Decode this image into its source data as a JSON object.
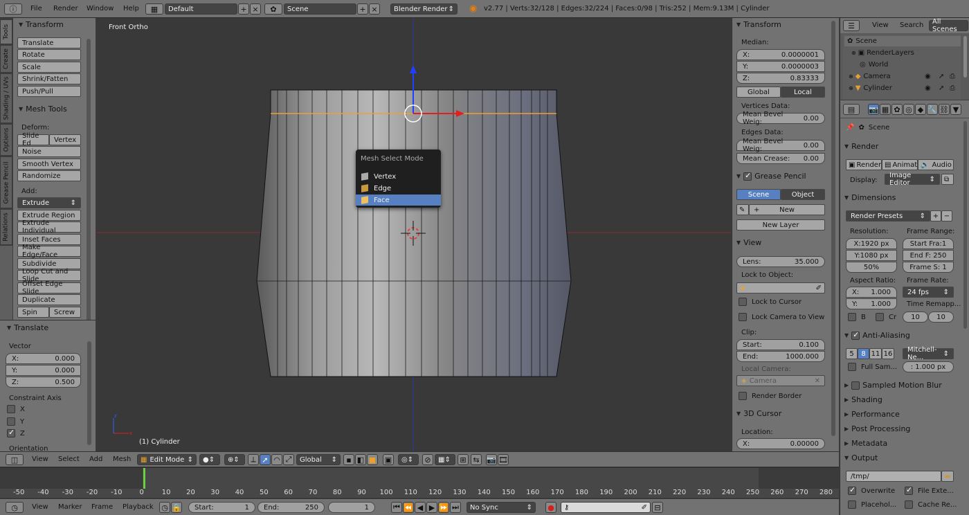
{
  "topbar": {
    "menus": [
      "File",
      "Render",
      "Window",
      "Help"
    ],
    "layout": "Default",
    "scene": "Scene",
    "engine": "Blender Render",
    "stats": "v2.77 | Verts:32/128 | Edges:32/224 | Faces:0/98 | Tris:252 | Mem:9.13M | Cylinder"
  },
  "tabs_left": [
    "Tools",
    "Create",
    "Shading / UVs",
    "Options",
    "Grease Pencil",
    "Relations"
  ],
  "tools": {
    "transform_title": "Transform",
    "transform": [
      "Translate",
      "Rotate",
      "Scale",
      "Shrink/Fatten",
      "Push/Pull"
    ],
    "mesh_tools_title": "Mesh Tools",
    "deform_label": "Deform:",
    "slide_edge": "Slide Ed",
    "vertex": "Vertex",
    "noise": "Noise",
    "smooth_vertex": "Smooth Vertex",
    "randomize": "Randomize",
    "add_label": "Add:",
    "extrude": "Extrude",
    "add_items": [
      "Extrude Region",
      "Extrude Individual",
      "Inset Faces",
      "Make Edge/Face",
      "Subdivide",
      "Loop Cut and Slide",
      "Offset Edge Slide",
      "Duplicate"
    ],
    "spin": "Spin",
    "screw": "Screw"
  },
  "operator": {
    "title": "Translate",
    "vector_label": "Vector",
    "x": "X:",
    "xv": "0.000",
    "y": "Y:",
    "yv": "0.000",
    "z": "Z:",
    "zv": "0.500",
    "constraint_label": "Constraint Axis",
    "cx": "X",
    "cy": "Y",
    "cz": "Z",
    "orientation": "Orientation"
  },
  "viewport": {
    "view_name": "Front Ortho",
    "object_name": "(1) Cylinder"
  },
  "popup": {
    "title": "Mesh Select Mode",
    "items": [
      "Vertex",
      "Edge",
      "Face"
    ]
  },
  "npanel": {
    "transform_title": "Transform",
    "median": "Median:",
    "x": "X:",
    "xv": "0.0000001",
    "y": "Y:",
    "yv": "0.0000003",
    "z": "Z:",
    "zv": "0.83333",
    "global": "Global",
    "local": "Local",
    "vdata": "Vertices Data:",
    "mbw_label": "Mean Bevel Weig:",
    "mbw": "0.00",
    "edata": "Edges Data:",
    "mbw2": "0.00",
    "crease_label": "Mean Crease:",
    "crease": "0.00",
    "gp_title": "Grease Pencil",
    "scene": "Scene",
    "object": "Object",
    "new": "New",
    "new_layer": "New Layer",
    "view_title": "View",
    "lens_label": "Lens:",
    "lens": "35.000",
    "lock_obj": "Lock to Object:",
    "lock_cursor": "Lock to Cursor",
    "lock_camera": "Lock Camera to View",
    "clip": "Clip:",
    "start_label": "Start:",
    "start": "0.100",
    "end_label": "End:",
    "end": "1000.000",
    "local_camera": "Local Camera:",
    "camera": "Camera",
    "render_border": "Render Border",
    "cursor_title": "3D Cursor",
    "location": "Location:",
    "cx": "X:",
    "cxv": "0.00000"
  },
  "outliner": {
    "view": "View",
    "search": "Search",
    "all_scenes": "All Scenes",
    "items": [
      "Scene",
      "RenderLayers",
      "World",
      "Camera",
      "Cylinder"
    ]
  },
  "props": {
    "scene": "Scene",
    "render_title": "Render",
    "render": "Render",
    "animation": "Animati",
    "audio": "Audio",
    "display_label": "Display:",
    "display": "Image Editor",
    "dimensions": "Dimensions",
    "presets": "Render Presets",
    "resolution": "Resolution:",
    "resx": "X:1920 px",
    "resy": "Y:1080 px",
    "pct": "50%",
    "frame_range": "Frame Range:",
    "start": "Start Fra:1",
    "end": "End F: 250",
    "step": "Frame S: 1",
    "aspect": "Aspect Ratio:",
    "ax": "X:",
    "axv": "1.000",
    "ay": "Y:",
    "ayv": "1.000",
    "frame_rate": "Frame Rate:",
    "fps": "24 fps",
    "time_remap": "Time Remapp...",
    "b": "B",
    "cr": "Cr",
    "r10a": "10",
    "r10b": "10",
    "aa": "Anti-Aliasing",
    "aa_vals": [
      "5",
      "8",
      "11",
      "16"
    ],
    "filter": "Mitchell-Ne...",
    "full_sample": "Full Sam...",
    "px": ": 1.000 px",
    "motion_blur": "Sampled Motion Blur",
    "shading": "Shading",
    "performance": "Performance",
    "post": "Post Processing",
    "metadata": "Metadata",
    "output": "Output",
    "path": "/tmp/",
    "overwrite": "Overwrite",
    "file_ext": "File Exte...",
    "placeholders": "Placehol...",
    "cache": "Cache Re..."
  },
  "header3d": {
    "view": "View",
    "select": "Select",
    "add": "Add",
    "mesh": "Mesh",
    "mode": "Edit Mode",
    "orientation": "Global"
  },
  "timeline": {
    "ticks": [
      "-50",
      "-40",
      "-30",
      "-20",
      "-10",
      "0",
      "10",
      "20",
      "30",
      "40",
      "50",
      "60",
      "70",
      "80",
      "90",
      "100",
      "110",
      "120",
      "130",
      "140",
      "150",
      "160",
      "170",
      "180",
      "190",
      "200",
      "210",
      "220",
      "230",
      "240",
      "250",
      "260",
      "270",
      "280"
    ],
    "view": "View",
    "marker": "Marker",
    "frame": "Frame",
    "playback": "Playback",
    "start_label": "Start:",
    "start": "1",
    "end_label": "End:",
    "end": "250",
    "current": "1",
    "sync": "No Sync"
  }
}
